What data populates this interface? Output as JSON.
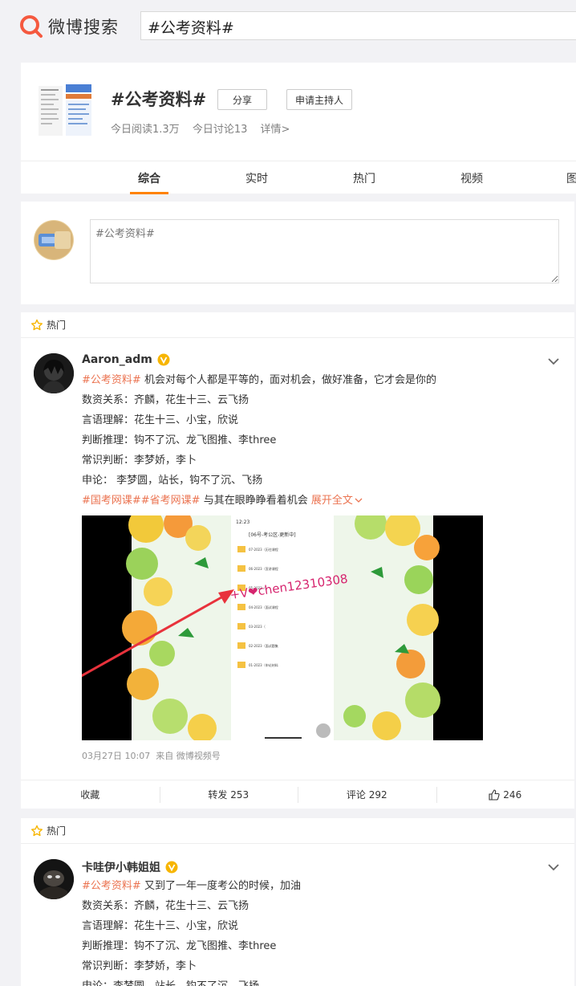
{
  "header": {
    "logo_text": "微博搜索",
    "search_value": "#公考资料#"
  },
  "topic": {
    "title": "#公考资料#",
    "share_label": "分享",
    "host_label": "申请主持人",
    "read_today": "今日阅读1.3万",
    "discuss_today": "今日讨论13",
    "detail_link": "详情>"
  },
  "tabs": [
    {
      "label": "综合",
      "active": true
    },
    {
      "label": "实时"
    },
    {
      "label": "热门"
    },
    {
      "label": "视频"
    },
    {
      "label": "图"
    }
  ],
  "composer": {
    "placeholder": "#公考资料#"
  },
  "posts": [
    {
      "section_label": "热门",
      "author": "Aaron_adm",
      "lines": [
        {
          "tag": "#公考资料#",
          "text": "机会对每个人都是平等的，面对机会，做好准备，它才会是你的"
        },
        {
          "text": "数资关系：齐麟，花生十三、云飞扬"
        },
        {
          "text": "言语理解：花生十三、小宝，欣说"
        },
        {
          "text": "判断推理：钩不了沉、龙飞图推、李three"
        },
        {
          "text": "常识判断：李梦娇，李卜"
        },
        {
          "text": "申论： 李梦圆，站长，钩不了沉、飞扬"
        },
        {
          "tag": "#国考网课##省考网课#",
          "text": "与其在眼睁睁看着机会",
          "more": "展开全文"
        }
      ],
      "video": {
        "status_time": "12:23",
        "folder_title": "[06号-考公区-更新中]",
        "overlay_text": "+V❤chen12310308",
        "folders": [
          "07-2023（历往课程",
          "06-2023（宣讲课程",
          "05-2023（",
          "04-2023（面试课程",
          "03-2023（",
          "02-2023（面试题集",
          "01-2023（申论材料"
        ]
      },
      "time": "03月27日 10:07",
      "source": "来自 微博视频号",
      "actions": {
        "collect": "收藏",
        "repost": "转发 253",
        "comment": "评论 292",
        "like": "246"
      }
    },
    {
      "section_label": "热门",
      "author": "卡哇伊小韩姐姐",
      "lines": [
        {
          "tag": "#公考资料#",
          "text": "又到了一年一度考公的时候，加油"
        },
        {
          "text": "数资关系：齐麟，花生十三、云飞扬"
        },
        {
          "text": "言语理解：花生十三、小宝，欣说"
        },
        {
          "text": "判断推理：钩不了沉、龙飞图推、李three"
        },
        {
          "text": "常识判断：李梦娇，李卜"
        },
        {
          "text": "申论：李梦圆，站长，钩不了沉、飞扬"
        }
      ]
    }
  ],
  "colors": {
    "accent": "#ff8200",
    "link": "#eb7350",
    "badge": "#f7b500"
  }
}
